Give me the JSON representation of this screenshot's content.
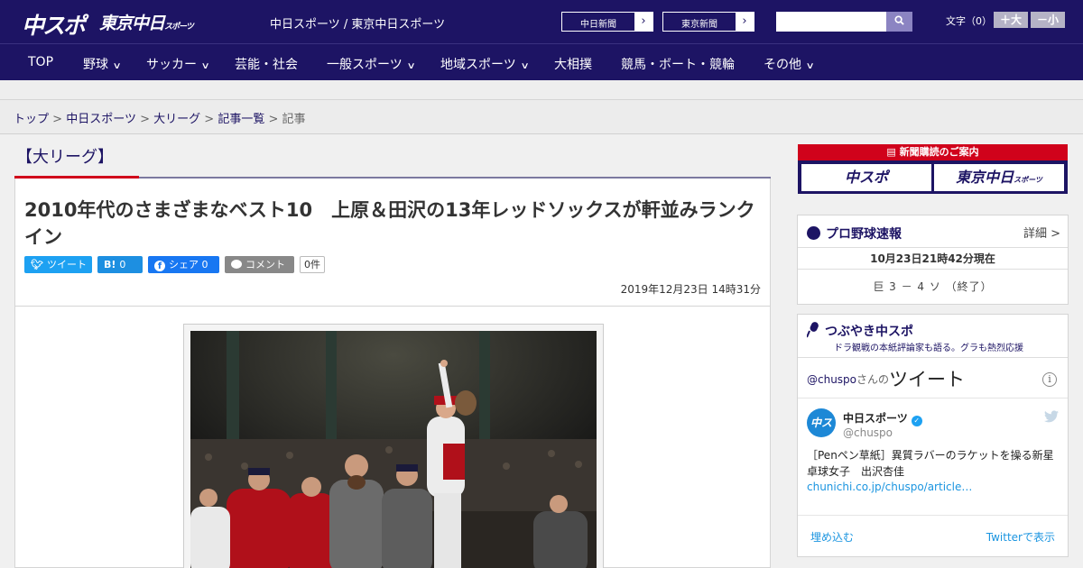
{
  "header": {
    "logo_main": "中スポ",
    "logo_tokyo": "東京中日",
    "logo_tokyo_small": "スポーツ",
    "site_names": "中日スポーツ / 東京中日スポーツ",
    "btn_chunichi": "中日新聞",
    "btn_tokyo": "東京新聞",
    "search_placeholder": "",
    "font_size_label": "文字（0）",
    "font_bigger": "＋大",
    "font_smaller": "－小"
  },
  "nav": {
    "items": [
      {
        "label": "TOP"
      },
      {
        "label": "野球"
      },
      {
        "label": "サッカー"
      },
      {
        "label": "芸能・社会"
      },
      {
        "label": "一般スポーツ"
      },
      {
        "label": "地域スポーツ"
      },
      {
        "label": "大相撲"
      },
      {
        "label": "競馬・ボート・競輪"
      },
      {
        "label": "その他"
      }
    ]
  },
  "breadcrumb": {
    "items": [
      "トップ",
      "中日スポーツ",
      "大リーグ",
      "記事一覧"
    ],
    "current": "記事",
    "separator": ">"
  },
  "article": {
    "category": "【大リーグ】",
    "title": "2010年代のさまざまなベスト10　上原＆田沢の13年レッドソックスが軒並みランクイン",
    "share": {
      "tweet": "ツイート",
      "hatena_icon": "B!",
      "hatena_count": "0",
      "facebook_share": "シェア",
      "facebook_count": "0",
      "comment": "コメント",
      "comment_count": "0件"
    },
    "date": "2019年12月23日 14時31分"
  },
  "sidebar": {
    "subscription": {
      "title": "新聞購読のご案内",
      "btn_chuspo": "中スポ",
      "btn_tokyo": "東京中日",
      "btn_tokyo_small": "スポーツ"
    },
    "baseball": {
      "title": "プロ野球速報",
      "detail": "詳細 >",
      "as_of": "10月23日21時42分現在",
      "score": "巨 3 － 4 ソ （終了）"
    },
    "tsubuyaki": {
      "title": "つぶやき中スポ",
      "subtitle": "ドラ観戦の本紙評論家も語る。グラも熱烈応援",
      "handle_prefix": "@chuspo",
      "san": "さんの",
      "tweets_label": "ツイート",
      "account_name": "中日スポーツ",
      "account_handle": "@chuspo",
      "avatar_text": "中スポ",
      "tweet_text": "［Penペン草紙］異質ラバーのラケットを操る新星　卓球女子　出沢杏佳",
      "tweet_link": "chunichi.co.jp/chuspo/article…",
      "embed": "埋め込む",
      "view_on_twitter": "Twitterで表示"
    }
  }
}
